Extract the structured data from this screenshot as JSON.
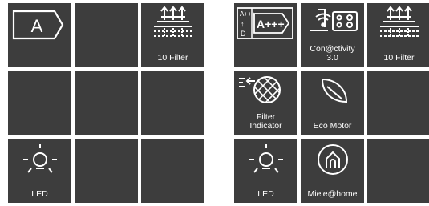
{
  "left_grid": {
    "energy_class": "A",
    "filter_label": "10 Filter",
    "led_label": "LED"
  },
  "right_grid": {
    "energy_scale_top": "A+++",
    "energy_scale_arrow": "↑",
    "energy_scale_bottom": "D",
    "energy_class": "A+++",
    "connectivity_label": "Con@ctivity\n3.0",
    "filter_label": "10 Filter",
    "filter_indicator_label": "Filter\nIndicator",
    "eco_motor_label": "Eco Motor",
    "led_label": "LED",
    "miele_home_label": "Miele@home"
  },
  "colors": {
    "tile": "#3d3d3d",
    "icon": "#ffffff",
    "page": "#ffffff"
  },
  "icons": [
    "energy-label-icon",
    "grease-filter-icon",
    "light-bulb-icon",
    "energy-scale-icon",
    "connectivity-hob-icon",
    "filter-indicator-icon",
    "eco-leaf-icon",
    "miele-home-icon"
  ]
}
